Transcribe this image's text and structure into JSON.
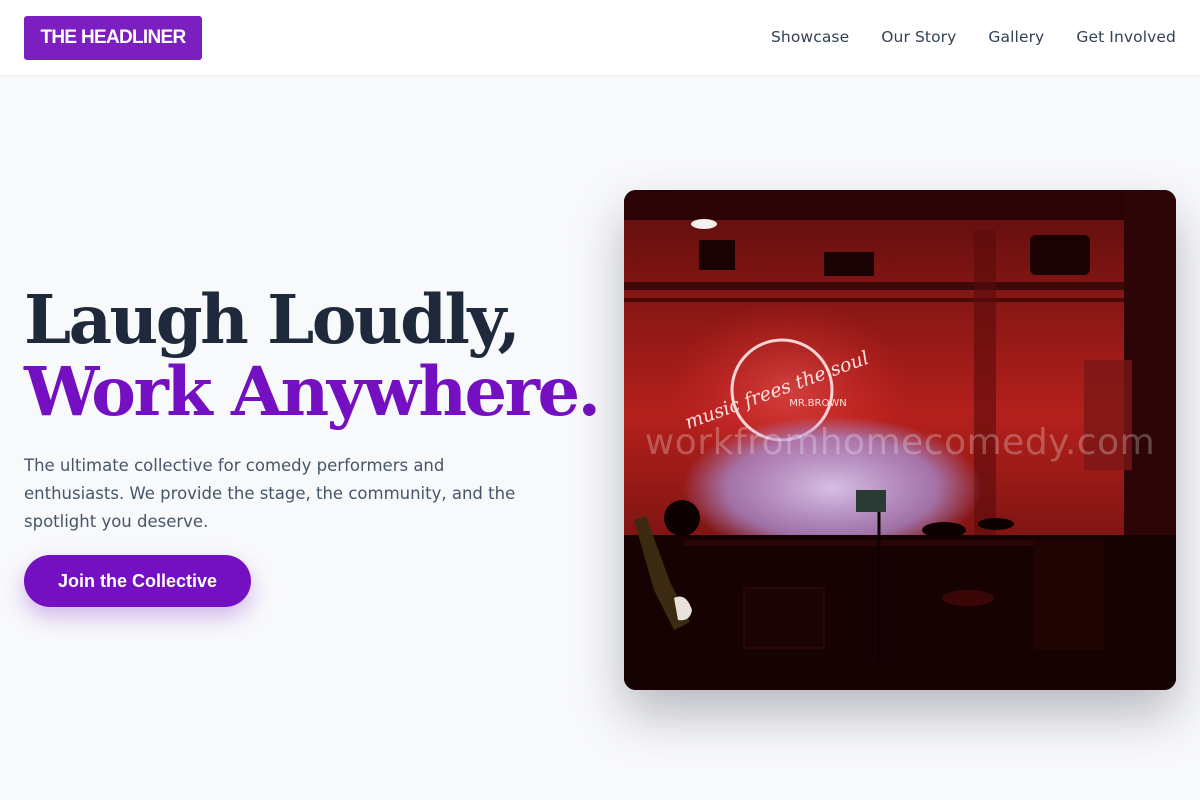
{
  "brand": {
    "logo_text": "THE HEADLINER",
    "accent_color": "#7410c1"
  },
  "nav": {
    "items": [
      {
        "label": "Showcase"
      },
      {
        "label": "Our Story"
      },
      {
        "label": "Gallery"
      },
      {
        "label": "Get Involved"
      }
    ]
  },
  "hero": {
    "title_line1": "Laugh Loudly,",
    "title_line2": "Work Anywhere.",
    "description": "The ultimate collective for comedy performers and enthusiasts. We provide the stage, the community, and the spotlight you deserve.",
    "cta_label": "Join the Collective"
  },
  "image": {
    "neon_sign_text": "music frees the soul",
    "neon_sign_subtext": "MR.BROWN",
    "watermark": "workfromhomecomedy.com"
  }
}
